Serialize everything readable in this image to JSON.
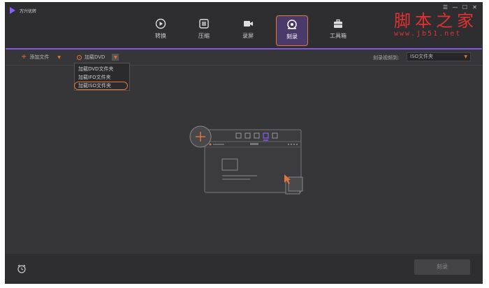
{
  "app": {
    "title": "万兴优转",
    "accent": "#8b5cf6",
    "orange": "#e0743a"
  },
  "window_buttons": [
    "☰",
    "—",
    "☐",
    "✕"
  ],
  "nav": [
    {
      "label": "转换",
      "icon": "convert-icon"
    },
    {
      "label": "压缩",
      "icon": "compress-icon"
    },
    {
      "label": "录屏",
      "icon": "record-icon"
    },
    {
      "label": "刻录",
      "icon": "burn-icon",
      "active": true
    },
    {
      "label": "工具箱",
      "icon": "toolbox-icon"
    }
  ],
  "watermark": {
    "title": "脚本之家",
    "url": "www.jb51.net"
  },
  "toolbar": {
    "add_files": "添加文件",
    "load_dvd": "加载DVD",
    "burn_to_label": "刻录视频到:",
    "burn_to_value": "ISO文件夹"
  },
  "dvd_menu": [
    "加载DVD文件夹",
    "加载IFO文件夹",
    "加载ISO文件夹"
  ],
  "bottom": {
    "burn_button": "刻录"
  }
}
